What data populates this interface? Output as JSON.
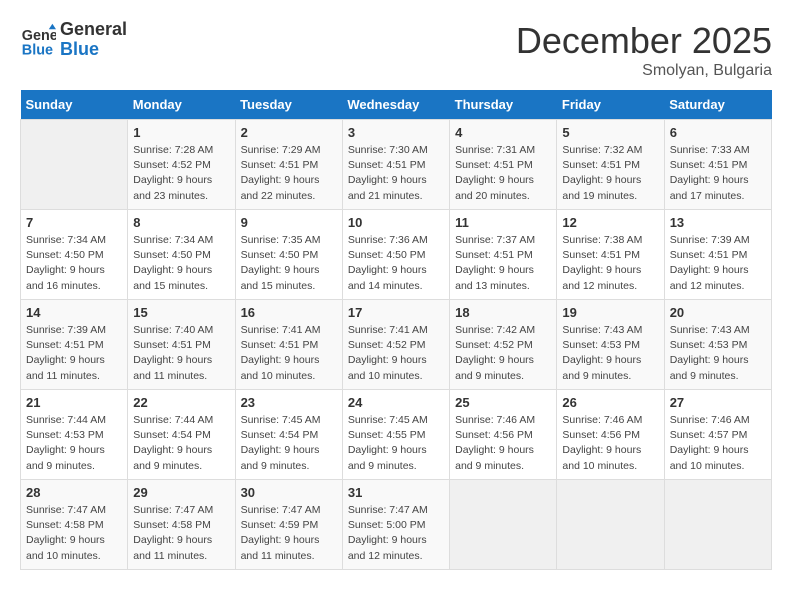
{
  "header": {
    "logo_line1": "General",
    "logo_line2": "Blue",
    "month": "December 2025",
    "location": "Smolyan, Bulgaria"
  },
  "weekdays": [
    "Sunday",
    "Monday",
    "Tuesday",
    "Wednesday",
    "Thursday",
    "Friday",
    "Saturday"
  ],
  "weeks": [
    [
      {
        "day": "",
        "detail": ""
      },
      {
        "day": "1",
        "detail": "Sunrise: 7:28 AM\nSunset: 4:52 PM\nDaylight: 9 hours\nand 23 minutes."
      },
      {
        "day": "2",
        "detail": "Sunrise: 7:29 AM\nSunset: 4:51 PM\nDaylight: 9 hours\nand 22 minutes."
      },
      {
        "day": "3",
        "detail": "Sunrise: 7:30 AM\nSunset: 4:51 PM\nDaylight: 9 hours\nand 21 minutes."
      },
      {
        "day": "4",
        "detail": "Sunrise: 7:31 AM\nSunset: 4:51 PM\nDaylight: 9 hours\nand 20 minutes."
      },
      {
        "day": "5",
        "detail": "Sunrise: 7:32 AM\nSunset: 4:51 PM\nDaylight: 9 hours\nand 19 minutes."
      },
      {
        "day": "6",
        "detail": "Sunrise: 7:33 AM\nSunset: 4:51 PM\nDaylight: 9 hours\nand 17 minutes."
      }
    ],
    [
      {
        "day": "7",
        "detail": "Sunrise: 7:34 AM\nSunset: 4:50 PM\nDaylight: 9 hours\nand 16 minutes."
      },
      {
        "day": "8",
        "detail": "Sunrise: 7:34 AM\nSunset: 4:50 PM\nDaylight: 9 hours\nand 15 minutes."
      },
      {
        "day": "9",
        "detail": "Sunrise: 7:35 AM\nSunset: 4:50 PM\nDaylight: 9 hours\nand 15 minutes."
      },
      {
        "day": "10",
        "detail": "Sunrise: 7:36 AM\nSunset: 4:50 PM\nDaylight: 9 hours\nand 14 minutes."
      },
      {
        "day": "11",
        "detail": "Sunrise: 7:37 AM\nSunset: 4:51 PM\nDaylight: 9 hours\nand 13 minutes."
      },
      {
        "day": "12",
        "detail": "Sunrise: 7:38 AM\nSunset: 4:51 PM\nDaylight: 9 hours\nand 12 minutes."
      },
      {
        "day": "13",
        "detail": "Sunrise: 7:39 AM\nSunset: 4:51 PM\nDaylight: 9 hours\nand 12 minutes."
      }
    ],
    [
      {
        "day": "14",
        "detail": "Sunrise: 7:39 AM\nSunset: 4:51 PM\nDaylight: 9 hours\nand 11 minutes."
      },
      {
        "day": "15",
        "detail": "Sunrise: 7:40 AM\nSunset: 4:51 PM\nDaylight: 9 hours\nand 11 minutes."
      },
      {
        "day": "16",
        "detail": "Sunrise: 7:41 AM\nSunset: 4:51 PM\nDaylight: 9 hours\nand 10 minutes."
      },
      {
        "day": "17",
        "detail": "Sunrise: 7:41 AM\nSunset: 4:52 PM\nDaylight: 9 hours\nand 10 minutes."
      },
      {
        "day": "18",
        "detail": "Sunrise: 7:42 AM\nSunset: 4:52 PM\nDaylight: 9 hours\nand 9 minutes."
      },
      {
        "day": "19",
        "detail": "Sunrise: 7:43 AM\nSunset: 4:53 PM\nDaylight: 9 hours\nand 9 minutes."
      },
      {
        "day": "20",
        "detail": "Sunrise: 7:43 AM\nSunset: 4:53 PM\nDaylight: 9 hours\nand 9 minutes."
      }
    ],
    [
      {
        "day": "21",
        "detail": "Sunrise: 7:44 AM\nSunset: 4:53 PM\nDaylight: 9 hours\nand 9 minutes."
      },
      {
        "day": "22",
        "detail": "Sunrise: 7:44 AM\nSunset: 4:54 PM\nDaylight: 9 hours\nand 9 minutes."
      },
      {
        "day": "23",
        "detail": "Sunrise: 7:45 AM\nSunset: 4:54 PM\nDaylight: 9 hours\nand 9 minutes."
      },
      {
        "day": "24",
        "detail": "Sunrise: 7:45 AM\nSunset: 4:55 PM\nDaylight: 9 hours\nand 9 minutes."
      },
      {
        "day": "25",
        "detail": "Sunrise: 7:46 AM\nSunset: 4:56 PM\nDaylight: 9 hours\nand 9 minutes."
      },
      {
        "day": "26",
        "detail": "Sunrise: 7:46 AM\nSunset: 4:56 PM\nDaylight: 9 hours\nand 10 minutes."
      },
      {
        "day": "27",
        "detail": "Sunrise: 7:46 AM\nSunset: 4:57 PM\nDaylight: 9 hours\nand 10 minutes."
      }
    ],
    [
      {
        "day": "28",
        "detail": "Sunrise: 7:47 AM\nSunset: 4:58 PM\nDaylight: 9 hours\nand 10 minutes."
      },
      {
        "day": "29",
        "detail": "Sunrise: 7:47 AM\nSunset: 4:58 PM\nDaylight: 9 hours\nand 11 minutes."
      },
      {
        "day": "30",
        "detail": "Sunrise: 7:47 AM\nSunset: 4:59 PM\nDaylight: 9 hours\nand 11 minutes."
      },
      {
        "day": "31",
        "detail": "Sunrise: 7:47 AM\nSunset: 5:00 PM\nDaylight: 9 hours\nand 12 minutes."
      },
      {
        "day": "",
        "detail": ""
      },
      {
        "day": "",
        "detail": ""
      },
      {
        "day": "",
        "detail": ""
      }
    ]
  ]
}
